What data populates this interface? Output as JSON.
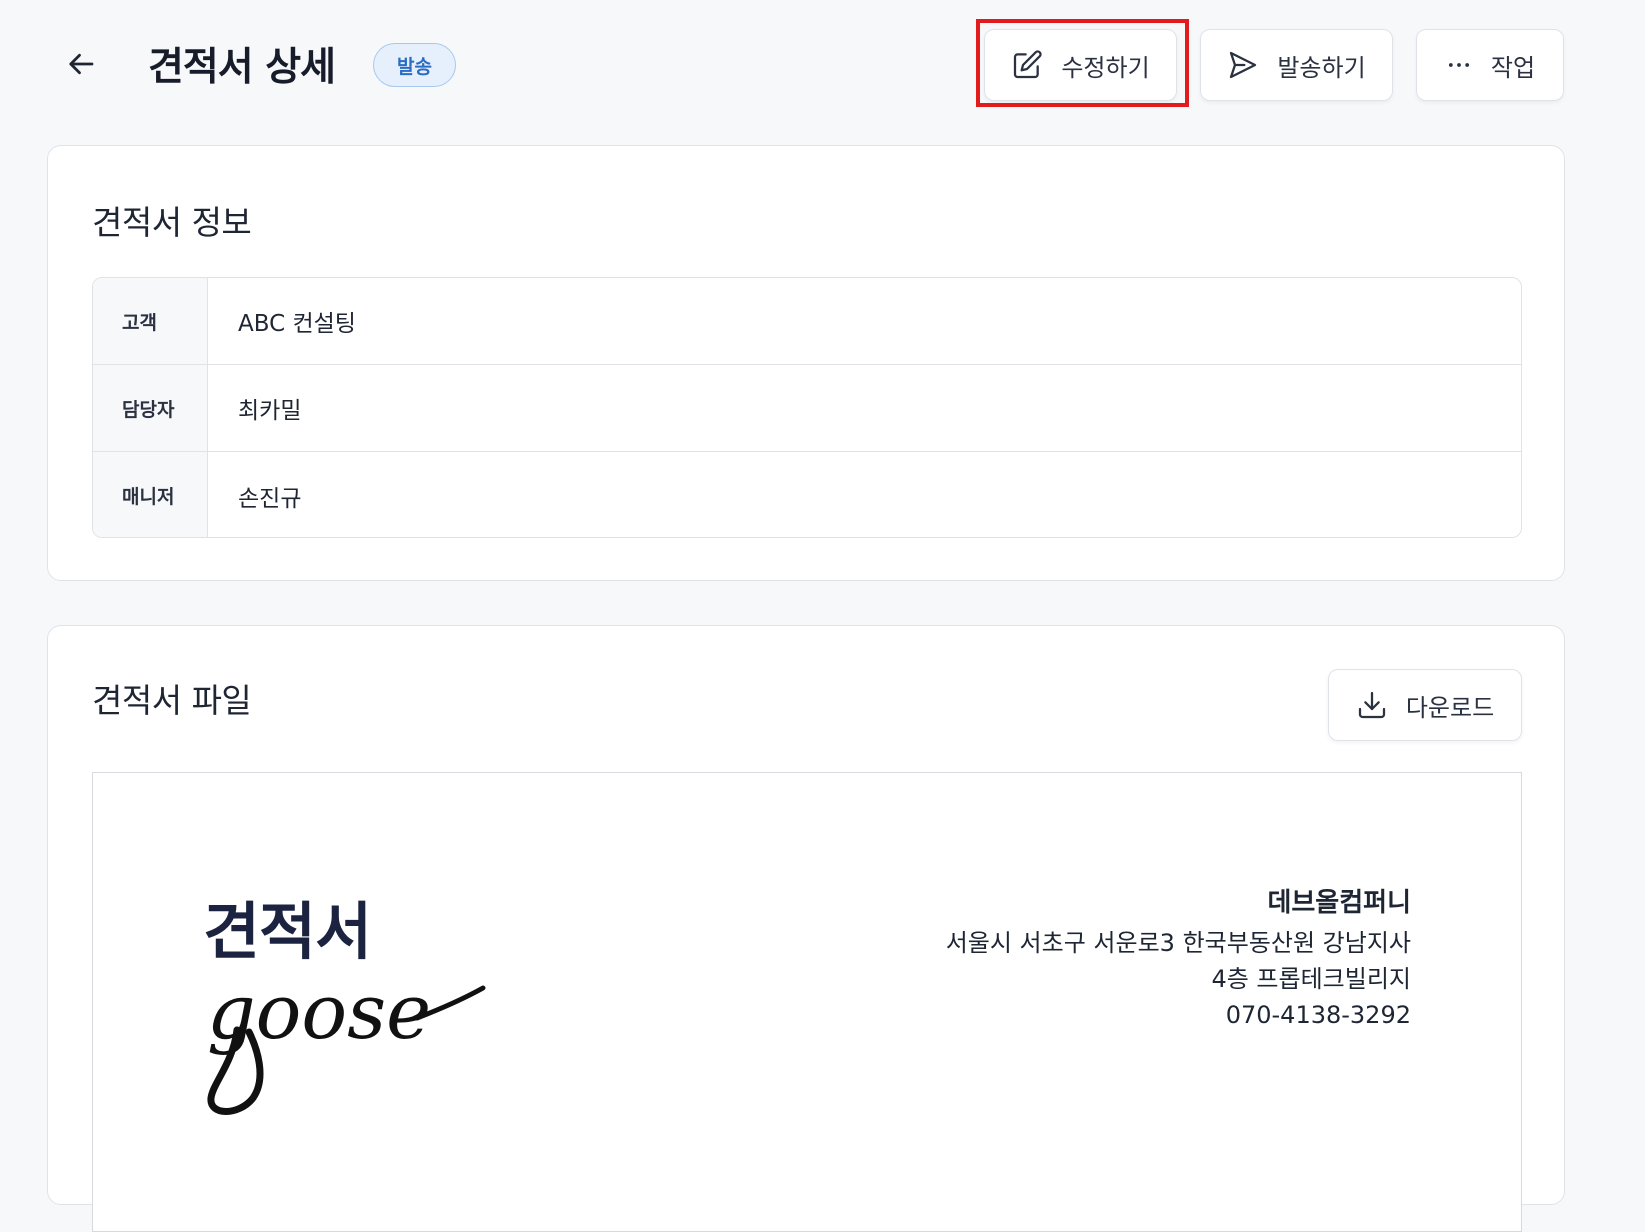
{
  "header": {
    "title": "견적서 상세",
    "status": "발송",
    "edit_label": "수정하기",
    "send_label": "발송하기",
    "more_label": "작업"
  },
  "info": {
    "title": "견적서 정보",
    "rows": [
      {
        "label": "고객",
        "value": "ABC 컨설팅"
      },
      {
        "label": "담당자",
        "value": "최카밀"
      },
      {
        "label": "매니저",
        "value": "손진규"
      }
    ]
  },
  "file": {
    "title": "견적서 파일",
    "download_label": "다운로드",
    "document": {
      "title": "견적서",
      "logo_text": "goose",
      "company_name": "데브올컴퍼니",
      "address_line1": "서울시 서초구 서운로3 한국부동산원 강남지사",
      "address_line2": "4층 프롭테크빌리지",
      "phone": "070-4138-3292"
    }
  },
  "icons": {
    "back": "arrow-left-icon",
    "edit": "pencil-icon",
    "send": "send-icon",
    "more": "ellipsis-icon",
    "download": "download-icon"
  },
  "colors": {
    "highlight": "#e21c1c",
    "badge_bg": "#e6f0fc",
    "badge_text": "#2b6cc4"
  }
}
